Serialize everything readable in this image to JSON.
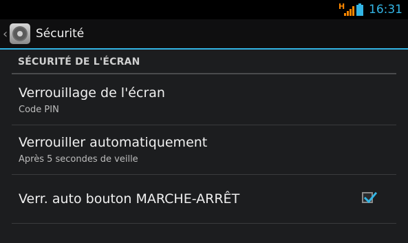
{
  "status_bar": {
    "network_label": "H",
    "time": "16:31",
    "accent_color": "#33b5e5",
    "signal_color": "#ff8800"
  },
  "action_bar": {
    "icon": "settings-gear-icon",
    "title": "Sécurité"
  },
  "section": {
    "header": "SÉCURITÉ DE L'ÉCRAN"
  },
  "preferences": [
    {
      "title": "Verrouillage de l'écran",
      "summary": "Code PIN"
    },
    {
      "title": "Verrouiller automatiquement",
      "summary": "Après 5 secondes de veille"
    },
    {
      "title": "Verr. auto bouton MARCHE-ARRÊT",
      "checked": true
    }
  ]
}
